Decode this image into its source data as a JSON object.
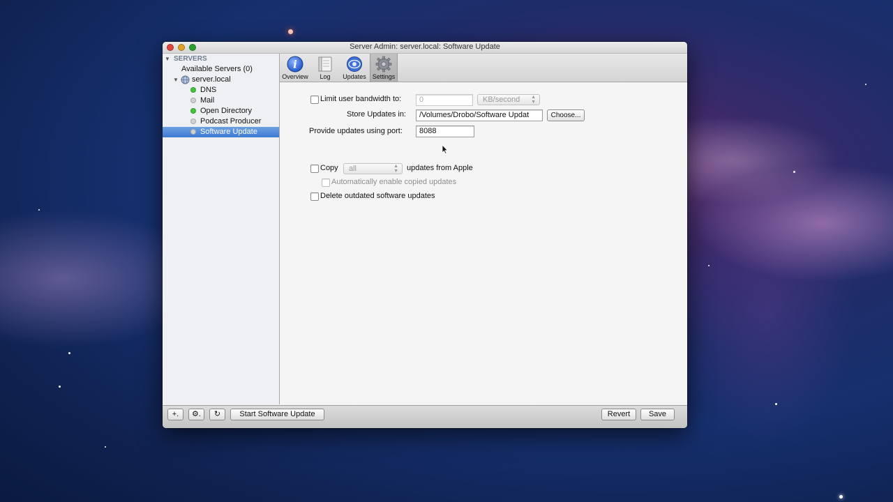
{
  "window": {
    "title": "Server Admin: server.local: Software Update"
  },
  "sidebar": {
    "header": "SERVERS",
    "available": "Available Servers (0)",
    "server": "server.local",
    "services": [
      {
        "label": "DNS",
        "status": "green"
      },
      {
        "label": "Mail",
        "status": "gray"
      },
      {
        "label": "Open Directory",
        "status": "green"
      },
      {
        "label": "Podcast Producer",
        "status": "gray"
      },
      {
        "label": "Software Update",
        "status": "gray",
        "selected": true
      }
    ]
  },
  "toolbar": {
    "items": [
      {
        "label": "Overview",
        "icon": "info-icon"
      },
      {
        "label": "Log",
        "icon": "log-icon"
      },
      {
        "label": "Updates",
        "icon": "updates-icon"
      },
      {
        "label": "Settings",
        "icon": "gear-icon",
        "active": true
      }
    ]
  },
  "settings": {
    "limit_bandwidth_label": "Limit user bandwidth to:",
    "bandwidth_value": "0",
    "bandwidth_unit": "KB/second",
    "store_updates_label": "Store Updates in:",
    "store_path": "/Volumes/Drobo/Software Updat",
    "choose_button": "Choose...",
    "port_label": "Provide updates using port:",
    "port_value": "8088",
    "copy_label": "Copy",
    "copy_option": "all",
    "updates_from_label": "updates from Apple",
    "auto_enable_label": "Automatically enable copied updates",
    "delete_outdated_label": "Delete outdated software updates"
  },
  "bottom": {
    "add_label": "+.",
    "action_label": "⚙.",
    "refresh_label": "↻",
    "start_button": "Start Software Update",
    "revert_button": "Revert",
    "save_button": "Save"
  },
  "colors": {
    "selection": "#3d7ad4",
    "status_green": "#43c43a",
    "status_gray": "#d2d2d2"
  }
}
